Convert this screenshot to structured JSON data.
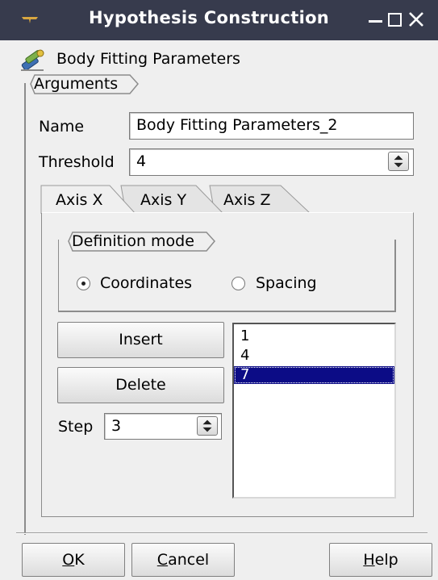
{
  "window": {
    "title": "Hypothesis Construction",
    "colors": {
      "titlebar": "#373b4d",
      "selection": "#0c0c86"
    }
  },
  "header": {
    "title": "Body Fitting Parameters",
    "icon": "hypothesis-wrench-icon"
  },
  "arguments": {
    "label": "Arguments",
    "name_label": "Name",
    "name_value": "Body Fitting Parameters_2",
    "threshold_label": "Threshold",
    "threshold_value": "4"
  },
  "tabs": [
    {
      "label": "Axis X",
      "active": true
    },
    {
      "label": "Axis Y",
      "active": false
    },
    {
      "label": "Axis Z",
      "active": false
    }
  ],
  "definition": {
    "label": "Definition mode",
    "options": [
      {
        "label": "Coordinates",
        "selected": true
      },
      {
        "label": "Spacing",
        "selected": false
      }
    ]
  },
  "actions": {
    "insert": "Insert",
    "delete": "Delete"
  },
  "step": {
    "label": "Step",
    "value": "3"
  },
  "coordinates": {
    "items": [
      "1",
      "4",
      "7"
    ],
    "selected_index": 2
  },
  "footer": {
    "ok_mnemonic": "O",
    "ok_rest": "K",
    "cancel_mnemonic": "C",
    "cancel_rest": "ancel",
    "help_mnemonic": "H",
    "help_rest": "elp"
  }
}
